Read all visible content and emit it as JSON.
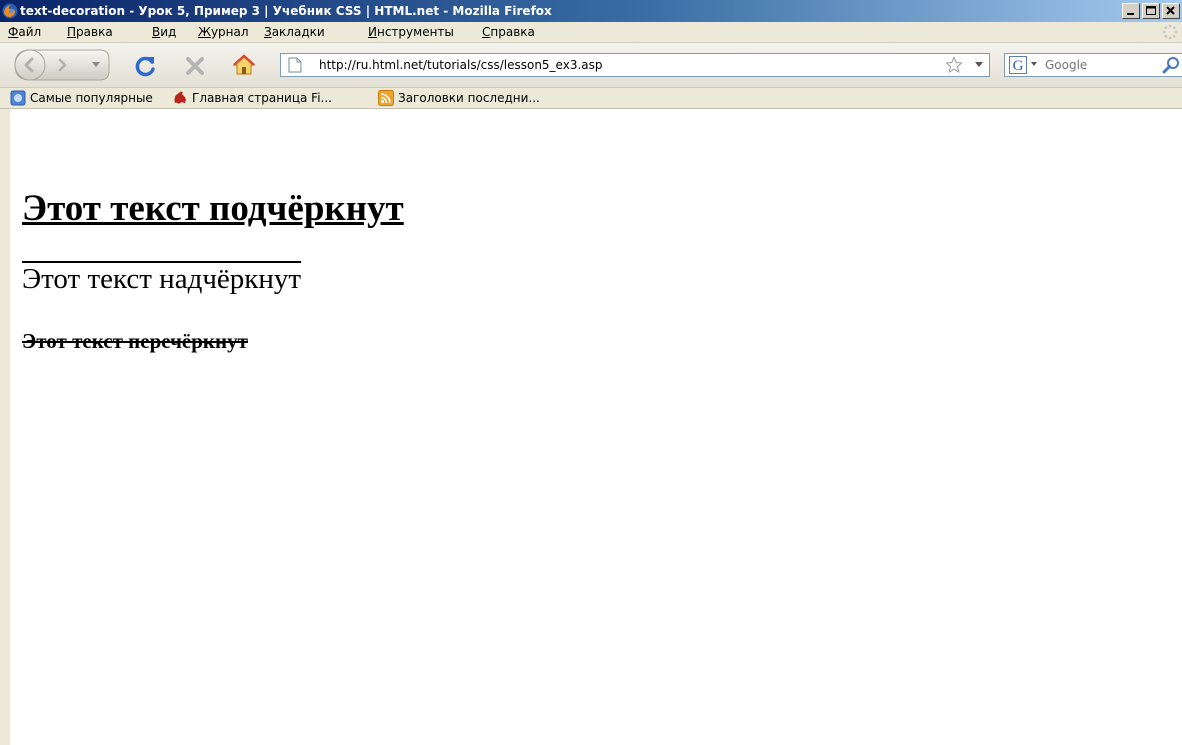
{
  "window": {
    "title": "text-decoration - Урок 5, Пример 3 | Учебник CSS | HTML.net - Mozilla Firefox",
    "controls": [
      "minimize",
      "maximize",
      "close"
    ]
  },
  "menu": {
    "items": [
      {
        "label": "Файл",
        "accel": "Ф",
        "rest": "айл"
      },
      {
        "label": "Правка",
        "accel": "П",
        "rest": "равка"
      },
      {
        "label": "Вид",
        "accel": "В",
        "rest": "ид"
      },
      {
        "label": "Журнал",
        "accel": "Ж",
        "rest": "урнал"
      },
      {
        "label": "Закладки",
        "accel": "З",
        "rest": "акладки"
      },
      {
        "label": "Инструменты",
        "accel": "И",
        "rest": "нструменты"
      },
      {
        "label": "Справка",
        "accel": "С",
        "rest": "правка"
      }
    ]
  },
  "navigation": {
    "url": "http://ru.html.net/tutorials/css/lesson5_ex3.asp",
    "search_placeholder": "Google",
    "icons": [
      "back-icon",
      "forward-icon",
      "history-dropdown-icon",
      "reload-icon",
      "stop-icon",
      "home-icon",
      "page-icon",
      "bookmark-star-icon",
      "url-dropdown-icon",
      "google-icon",
      "search-engine-dropdown-icon",
      "magnifier-icon"
    ]
  },
  "bookmarks": {
    "items": [
      {
        "label": "Самые популярные",
        "icon": "most-visited-icon"
      },
      {
        "label": "Главная страница Fi...",
        "icon": "firefox-home-icon"
      },
      {
        "label": "Заголовки последни...",
        "icon": "rss-feed-icon"
      }
    ]
  },
  "content": {
    "underlined_heading": "Этот текст подчёркнут",
    "overlined_heading": "Этот текст надчёркнут",
    "linethrough_heading": "Этот текст перечёркнут"
  },
  "colors": {
    "titlebar_start": "#0a246a",
    "titlebar_end": "#a6caf0",
    "chrome": "#ece9d8",
    "page_background": "#ffffff",
    "text": "#000000"
  }
}
